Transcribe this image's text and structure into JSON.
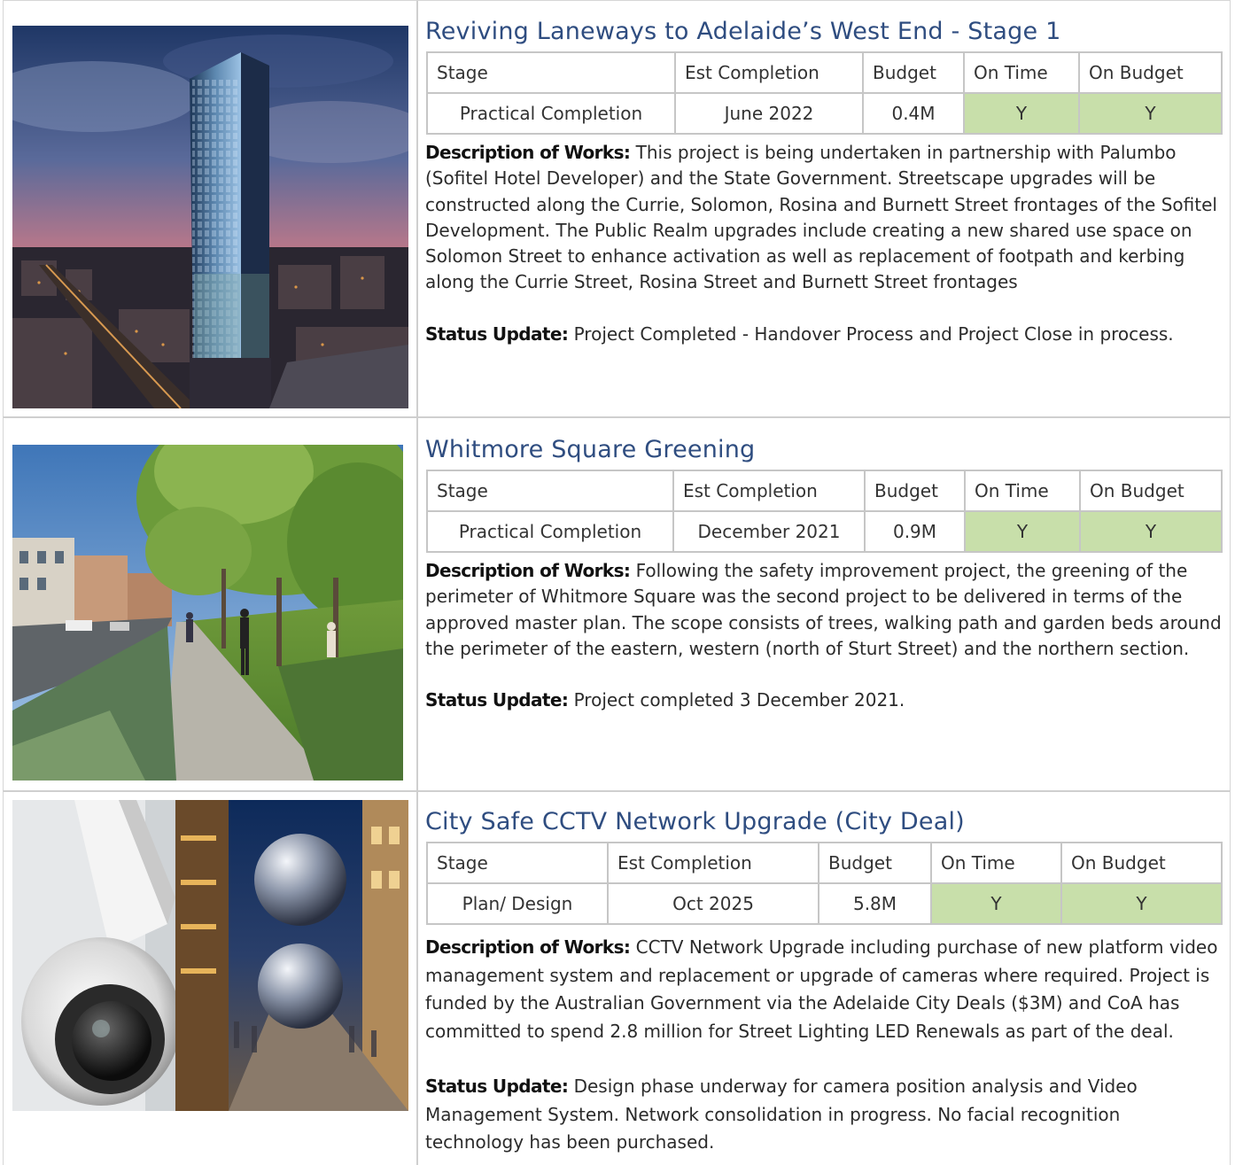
{
  "columns": [
    "Stage",
    "Est Completion",
    "Budget",
    "On Time",
    "On Budget"
  ],
  "labels": {
    "description": "Description of Works:",
    "status": "Status Update:"
  },
  "projects": [
    {
      "title": "Reviving Laneways to Adelaide’s West End - Stage 1",
      "image": "Night aerial view of Adelaide city with Sofitel hotel tower",
      "stage": "Practical Completion",
      "est_completion": "June 2022",
      "budget": "0.4M",
      "on_time": "Y",
      "on_budget": "Y",
      "description": "This project is being undertaken in partnership with Palumbo (Sofitel Hotel Developer) and the State Government. Streetscape upgrades will be constructed along the Currie, Solomon, Rosina and Burnett Street frontages of the Sofitel Development. The Public Realm upgrades include creating a new shared use space on Solomon Street to enhance activation as well as replacement of footpath and kerbing along the Currie Street, Rosina Street and Burnett Street frontages",
      "status": "Project Completed - Handover Process and Project Close in process."
    },
    {
      "title": "Whitmore Square Greening",
      "image": "Render of tree-lined walking path with garden beds",
      "stage": "Practical Completion",
      "est_completion": "December 2021",
      "budget": "0.9M",
      "on_time": "Y",
      "on_budget": "Y",
      "description": "Following the safety improvement project, the greening of the perimeter of Whitmore Square was the second project to be delivered in terms of the approved master plan. The scope consists of trees, walking path and garden beds around the perimeter of the eastern, western (north of Sturt Street) and the northern section.",
      "status": "Project completed 3 December 2021."
    },
    {
      "title": "City Safe CCTV Network Upgrade (City Deal)",
      "image": "CCTV dome camera and Rundle Mall spheres at night",
      "stage": "Plan/ Design",
      "est_completion": "Oct 2025",
      "budget": "5.8M",
      "on_time": "Y",
      "on_budget": "Y",
      "description": "CCTV Network Upgrade including purchase of new platform video management system and replacement or upgrade of cameras where required. Project is funded by the Australian Government via the Adelaide City Deals ($3M) and CoA has committed to spend 2.8 million for Street Lighting LED Renewals as part of the deal.",
      "status": " Design phase underway for camera position analysis and Video Management System. Network consolidation in progress. No facial recognition technology has been purchased."
    }
  ]
}
